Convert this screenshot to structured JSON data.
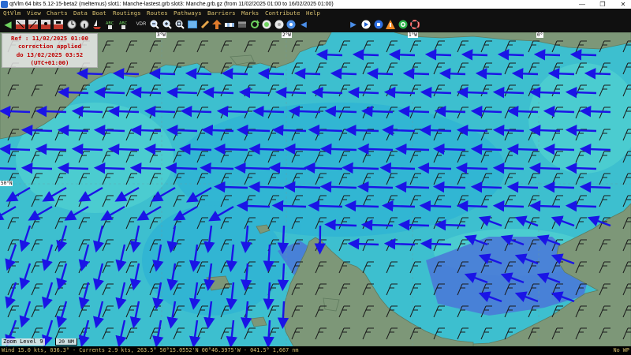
{
  "window": {
    "title": "qtVlm 64 bits 5.12-15-beta2 (meltemus) slot1: Manche-lastest.grb slot3: Manche.grb.gz (from 11/02/2025 01:00 to 16/02/2025 01:00)",
    "controls": [
      "—",
      "❐",
      "✕"
    ]
  },
  "menu": [
    "QtVlm",
    "View",
    "Charts",
    "Data",
    "Boat",
    "Routings",
    "Routes",
    "Pathways",
    "Barriers",
    "Marks",
    "Contribute",
    "Help"
  ],
  "toolbar": {
    "time_step": "1 h",
    "icons": [
      "back-icon",
      "grib-icon-1",
      "grib-icon-2",
      "grib-icon-3",
      "grib-icon-4",
      "clock-icon",
      "info-icon",
      "boat-icon",
      "polar-icon",
      "vmg-icon",
      "zoom-out-icon",
      "zoom-in-icon",
      "zoom-fit-icon",
      "map-icon",
      "pen-icon",
      "route-icon",
      "barrier-icon",
      "mark-icon",
      "refresh-icon",
      "globe-icon",
      "compass-icon",
      "center-icon",
      "play-back-icon",
      "play-forward-icon",
      "play-icon",
      "stop-icon",
      "warning-icon",
      "target-icon",
      "lifebuoy-icon"
    ]
  },
  "map": {
    "ref_box": {
      "line1": "Ref : 11/02/2025 01:00",
      "line2": "correction applied",
      "line3": "do 13/02/2025 03:52",
      "line4": "(UTC+01:00)"
    },
    "lon_labels": [
      "3°W",
      "2°W",
      "1°W",
      "0°"
    ],
    "lat_labels": [
      "50°N"
    ],
    "zoom_level": "Zoom Level 9",
    "scale": "20 NM"
  },
  "colors": {
    "sea": "#3dbfcf",
    "land": "#7d9778",
    "current_arrow": "#1a14e6",
    "wind_barb": "#1b1b1b"
  },
  "status": {
    "left": "Wind 15.0 kts, 036.3° - Currents 2.9 kts, 263.5° 50°15.0552'N 00°46.3975'W - 041.5° 1,667 nm",
    "right": "No WP"
  }
}
